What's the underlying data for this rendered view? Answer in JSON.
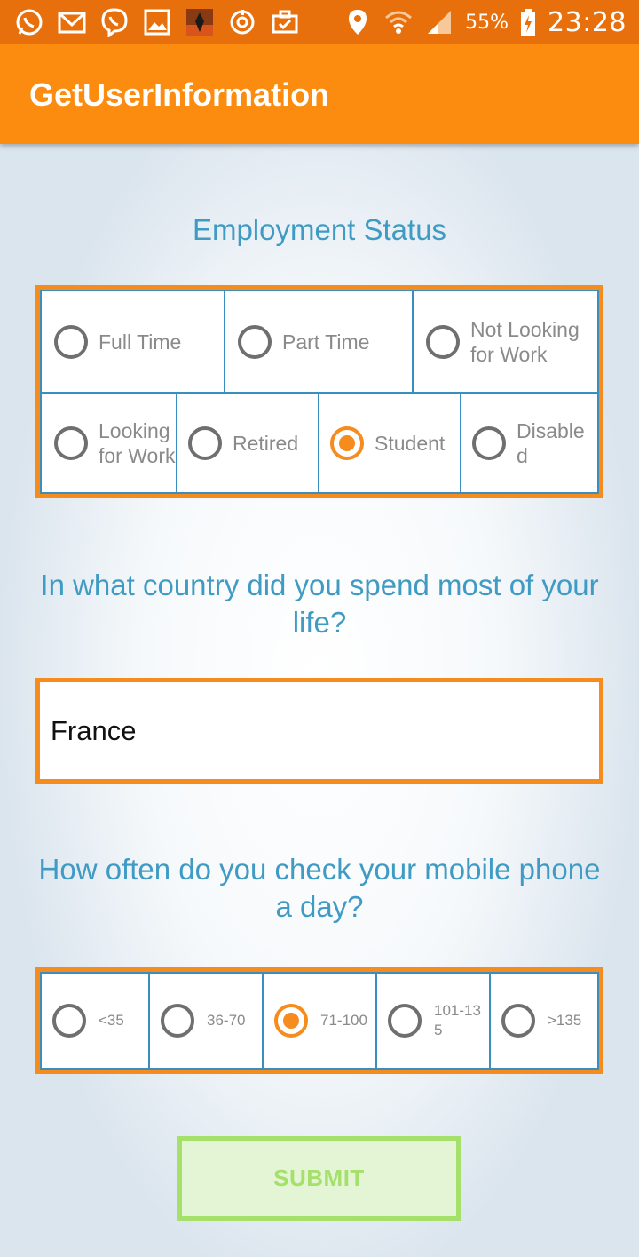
{
  "status_bar": {
    "icons_left": [
      "whatsapp-icon",
      "gmail-icon",
      "viber-icon",
      "gallery-icon",
      "game-icon",
      "sync-icon",
      "briefcase-icon"
    ],
    "battery": "55%",
    "time": "23:28"
  },
  "app_bar": {
    "title": "GetUserInformation"
  },
  "employment": {
    "title": "Employment Status",
    "options": [
      {
        "label": "Full Time",
        "checked": false
      },
      {
        "label": "Part Time",
        "checked": false
      },
      {
        "label": "Not Looking for Work",
        "checked": false
      },
      {
        "label": "Looking for Work",
        "checked": false
      },
      {
        "label": "Retired",
        "checked": false
      },
      {
        "label": "Student",
        "checked": true
      },
      {
        "label": "Disabled",
        "checked": false
      }
    ]
  },
  "country": {
    "title": "In what country did you spend most of your life?",
    "value": "France"
  },
  "phone_check": {
    "title": "How often do you check your mobile phone a day?",
    "options": [
      {
        "label": "<35",
        "checked": false
      },
      {
        "label": "36-70",
        "checked": false
      },
      {
        "label": "71-100",
        "checked": true
      },
      {
        "label": "101-135",
        "checked": false
      },
      {
        "label": ">135",
        "checked": false
      }
    ]
  },
  "submit": {
    "label": "SUBMIT"
  },
  "colors": {
    "status_bar": "#e8700c",
    "app_bar": "#fb8c10",
    "accent_orange": "#f68b1e",
    "title_blue": "#3f9bc3",
    "cell_border_blue": "#3b8fc0",
    "submit_green": "#a4e06a"
  }
}
